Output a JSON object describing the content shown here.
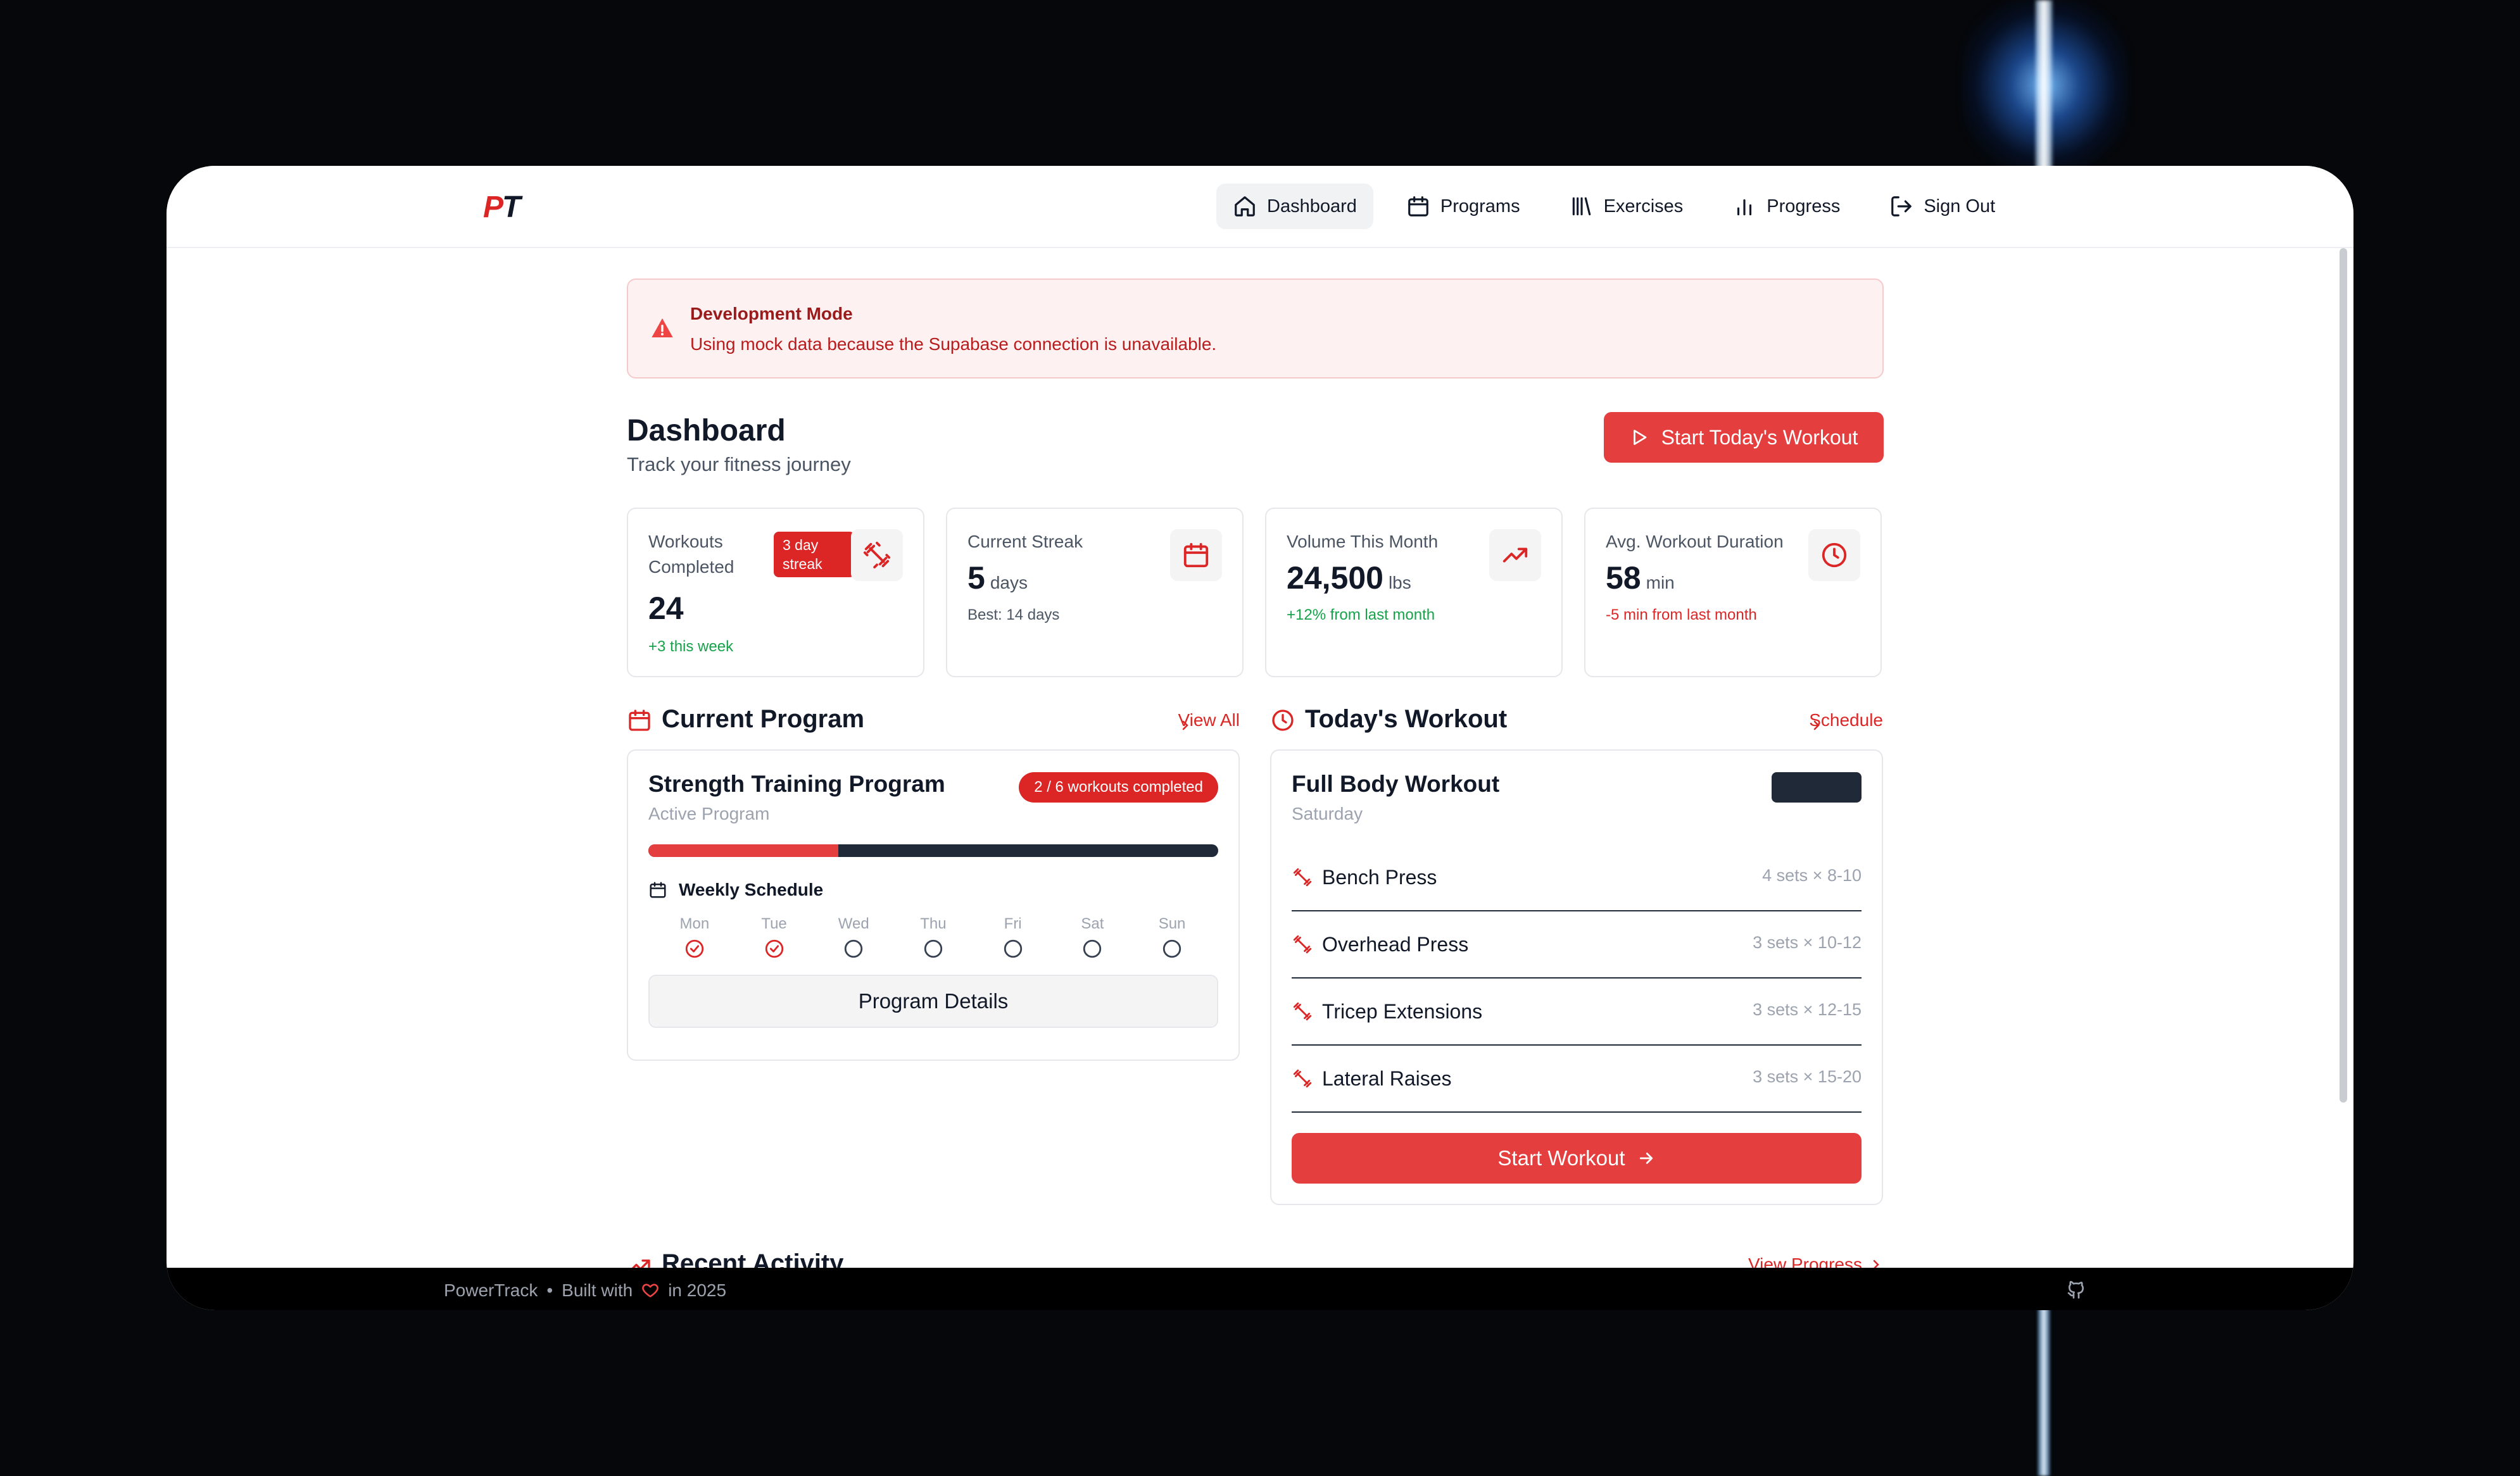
{
  "nav": {
    "logo_p": "P",
    "logo_t": "T",
    "items": [
      {
        "label": "Dashboard",
        "icon": "home-icon",
        "active": true
      },
      {
        "label": "Programs",
        "icon": "calendar-icon",
        "active": false
      },
      {
        "label": "Exercises",
        "icon": "library-icon",
        "active": false
      },
      {
        "label": "Progress",
        "icon": "bar-chart-icon",
        "active": false
      },
      {
        "label": "Sign Out",
        "icon": "log-out-icon",
        "active": false
      }
    ]
  },
  "alert": {
    "title": "Development Mode",
    "description": "Using mock data because the Supabase connection is unavailable."
  },
  "header": {
    "title": "Dashboard",
    "subtitle": "Track your fitness journey",
    "cta": "Start Today's Workout"
  },
  "stats": [
    {
      "label": "Workouts Completed",
      "value": "24",
      "unit": "",
      "note": "+3 this week",
      "badge": "3 day streak",
      "icon": "dumbbell-icon"
    },
    {
      "label": "Current Streak",
      "value": "5",
      "unit": "days",
      "note": "Best: 14 days",
      "icon": "calendar-icon"
    },
    {
      "label": "Volume This Month",
      "value": "24,500",
      "unit": "lbs",
      "note": "+12% from last month",
      "icon": "trending-up-icon"
    },
    {
      "label": "Avg. Workout Duration",
      "value": "58",
      "unit": "min",
      "note": "-5 min from last month",
      "icon": "clock-icon"
    }
  ],
  "current_program": {
    "section_title": "Current Program",
    "link": "View All",
    "name": "Strength Training Program",
    "status": "Active Program",
    "badge": "2 / 6 workouts completed",
    "progress": 0.333,
    "schedule_title": "Weekly Schedule",
    "days": [
      {
        "label": "Mon",
        "done": true
      },
      {
        "label": "Tue",
        "done": true
      },
      {
        "label": "Wed",
        "done": false
      },
      {
        "label": "Thu",
        "done": false
      },
      {
        "label": "Fri",
        "done": false
      },
      {
        "label": "Sat",
        "done": false
      },
      {
        "label": "Sun",
        "done": false
      }
    ],
    "button": "Program Details"
  },
  "todays_workout": {
    "section_title": "Today's Workout",
    "link": "Schedule",
    "name": "Full Body Workout",
    "day": "Saturday",
    "exercises": [
      {
        "name": "Bench Press",
        "sets": "4 sets × 8-10"
      },
      {
        "name": "Overhead Press",
        "sets": "3 sets × 10-12"
      },
      {
        "name": "Tricep Extensions",
        "sets": "3 sets × 12-15"
      },
      {
        "name": "Lateral Raises",
        "sets": "3 sets × 15-20"
      }
    ],
    "button": "Start Workout"
  },
  "recent_activity": {
    "title": "Recent Activity",
    "link": "View Progress"
  },
  "footer": {
    "brand": "PowerTrack",
    "separator": "•",
    "built_with": "Built with",
    "year_text": "in 2025"
  },
  "colors": {
    "accent": "#e53e3e",
    "accent_dark": "#dc2626",
    "success": "#16a34a",
    "dark": "#1f2937"
  }
}
